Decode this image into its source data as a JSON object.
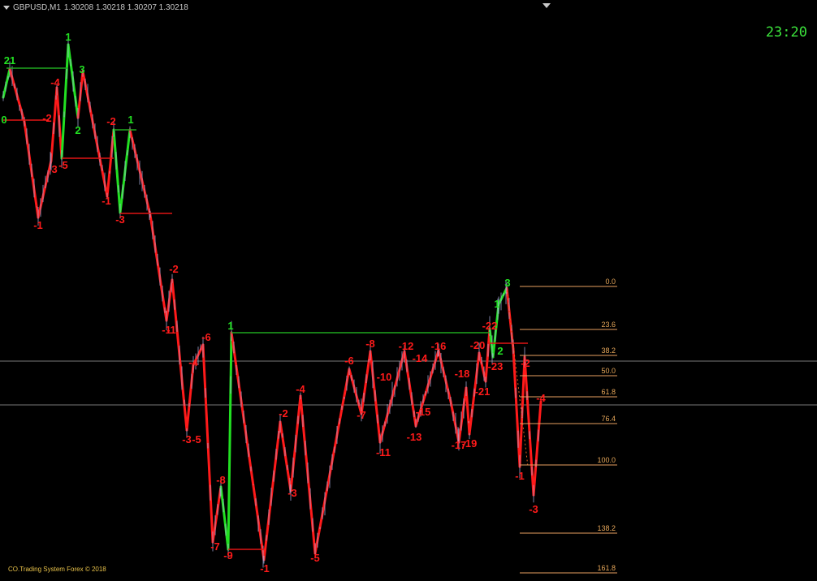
{
  "header": {
    "symbol": "GBPUSD,M1",
    "prices": "1.30208 1.30218 1.30207 1.30218"
  },
  "clock": "23:20",
  "footer": "CO.Trading System Forex © 2018",
  "colors": {
    "background": "#000000",
    "bull": "#22e022",
    "bear": "#ff1a1a",
    "fib": "#e8a060",
    "candle": "#b0b8e8",
    "guide": "#a0a0a0"
  },
  "fibonacci_levels": [
    "0.0",
    "23.6",
    "38.2",
    "50.0",
    "61.8",
    "76.4",
    "100.0",
    "138.2",
    "161.8"
  ],
  "wave_labels_red": [
    "-4",
    "-2",
    "-3",
    "-5",
    "-1",
    "-2",
    "-1",
    "-3",
    "-1",
    "-2",
    "-1",
    "-6",
    "-4",
    "-3",
    "-5",
    "-8",
    "-7",
    "-9",
    "-1",
    "-2",
    "-4",
    "-3",
    "-5",
    "-6",
    "-7",
    "-8",
    "-10",
    "-11",
    "-12",
    "-14",
    "-13",
    "-16",
    "-15",
    "-18",
    "-17",
    "-19",
    "-20",
    "-21",
    "-22",
    "-23",
    "-2",
    "-1",
    "-4",
    "-3"
  ],
  "wave_labels_green": [
    "21",
    "0",
    "1",
    "3",
    "2",
    "1",
    "1",
    "1",
    "2",
    "3"
  ]
}
